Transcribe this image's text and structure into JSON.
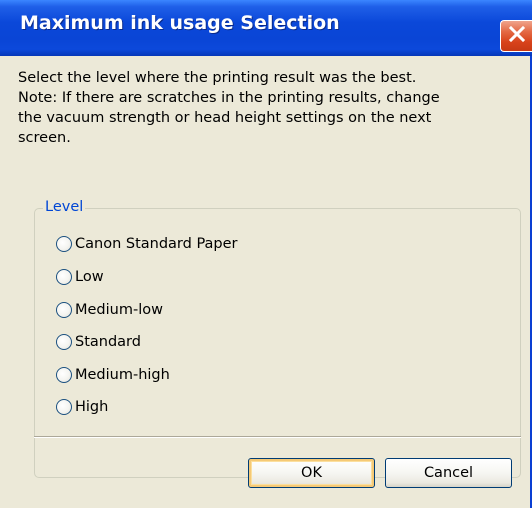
{
  "window": {
    "title": "Maximum ink usage Selection"
  },
  "description": {
    "line1": "Select the level where the printing result was the best.",
    "line2": "Note: If there are scratches in the printing results, change",
    "line3": "the vacuum strength or head height settings on the next",
    "line4": "screen."
  },
  "level_group": {
    "label": "Level",
    "options": [
      {
        "label": "Canon Standard Paper",
        "selected": false
      },
      {
        "label": "Low",
        "selected": false
      },
      {
        "label": "Medium-low",
        "selected": false
      },
      {
        "label": "Standard",
        "selected": false
      },
      {
        "label": "Medium-high",
        "selected": false
      },
      {
        "label": "High",
        "selected": false
      }
    ]
  },
  "buttons": {
    "ok_label": "OK",
    "cancel_label": "Cancel"
  },
  "colors": {
    "titlebar": "#0a45d6",
    "dialog_background": "#ece9d8",
    "group_label": "#0046d5",
    "close_button": "#d8431b"
  }
}
